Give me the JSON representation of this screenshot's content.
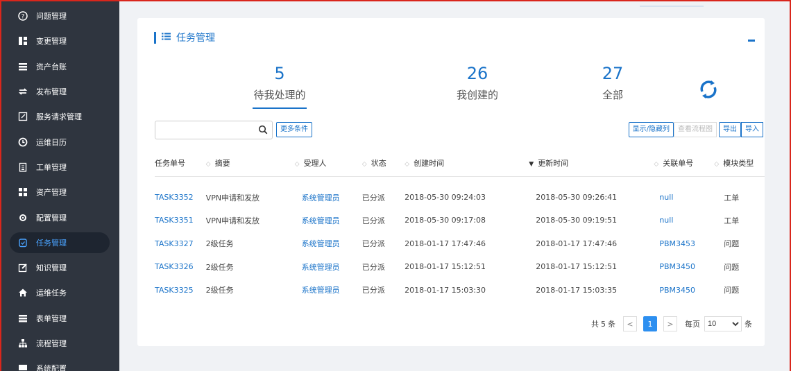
{
  "sidebar": {
    "items": [
      {
        "label": "问题管理",
        "icon": "question-circle-icon"
      },
      {
        "label": "变更管理",
        "icon": "change-icon"
      },
      {
        "label": "资产台账",
        "icon": "list-icon"
      },
      {
        "label": "发布管理",
        "icon": "exchange-icon"
      },
      {
        "label": "服务请求管理",
        "icon": "edit-square-icon"
      },
      {
        "label": "运维日历",
        "icon": "clock-icon"
      },
      {
        "label": "工单管理",
        "icon": "clipboard-icon"
      },
      {
        "label": "资产管理",
        "icon": "grid-icon"
      },
      {
        "label": "配置管理",
        "icon": "gear-icon"
      },
      {
        "label": "任务管理",
        "icon": "task-icon"
      },
      {
        "label": "知识管理",
        "icon": "pencil-icon"
      },
      {
        "label": "运维任务",
        "icon": "home-icon"
      },
      {
        "label": "表单管理",
        "icon": "list-icon"
      },
      {
        "label": "流程管理",
        "icon": "sitemap-icon"
      },
      {
        "label": "系统配置",
        "icon": "monitor-icon"
      }
    ]
  },
  "card": {
    "title": "任务管理",
    "stats": [
      {
        "num": "5",
        "label": "待我处理的"
      },
      {
        "num": "26",
        "label": "我创建的"
      },
      {
        "num": "27",
        "label": "全部"
      }
    ]
  },
  "toolbar": {
    "search_placeholder": "",
    "more_label": "更多条件",
    "toggle_cols_label": "显示/隐藏列",
    "flowchart_label": "查看流程图",
    "export_label": "导出",
    "import_label": "导入"
  },
  "table": {
    "headers": [
      "任务单号",
      "摘要",
      "受理人",
      "状态",
      "创建时间",
      "更新时间",
      "关联单号",
      "模块类型"
    ],
    "rows": [
      [
        "TASK3352",
        "VPN申请和发放",
        "系统管理员",
        "已分派",
        "2018-05-30 09:24:03",
        "2018-05-30 09:26:41",
        "null",
        "工单"
      ],
      [
        "TASK3351",
        "VPN申请和发放",
        "系统管理员",
        "已分派",
        "2018-05-30 09:17:08",
        "2018-05-30 09:19:51",
        "null",
        "工单"
      ],
      [
        "TASK3327",
        "2级任务",
        "系统管理员",
        "已分派",
        "2018-01-17 17:47:46",
        "2018-01-17 17:47:46",
        "PBM3453",
        "问题"
      ],
      [
        "TASK3326",
        "2级任务",
        "系统管理员",
        "已分派",
        "2018-01-17 15:12:51",
        "2018-01-17 15:12:51",
        "PBM3450",
        "问题"
      ],
      [
        "TASK3325",
        "2级任务",
        "系统管理员",
        "已分派",
        "2018-01-17 15:03:30",
        "2018-01-17 15:03:35",
        "PBM3450",
        "问题"
      ]
    ]
  },
  "pager": {
    "total_prefix": "共",
    "total": "5",
    "total_suffix": "条",
    "prev": "<",
    "current": "1",
    "next": ">",
    "per_page_label": "每页",
    "per_page": "10",
    "per_page_suffix": "条"
  },
  "colors": {
    "accent": "#1a73c9",
    "sidebar_bg": "#2f353f",
    "active": "#4aa3ff"
  }
}
